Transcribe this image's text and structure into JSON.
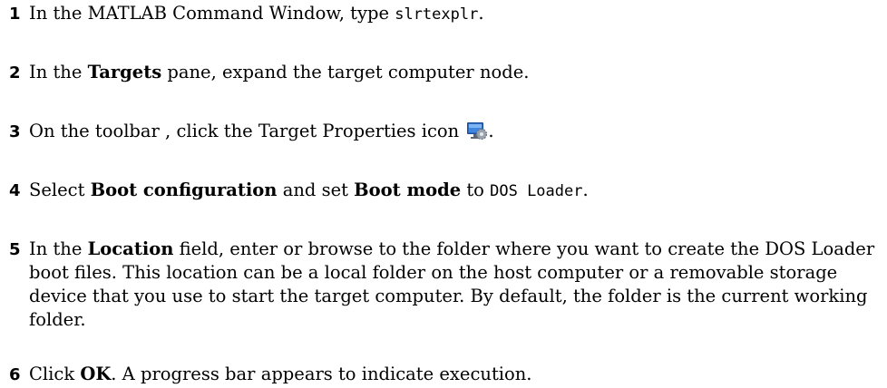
{
  "steps": [
    {
      "number": "1",
      "parts": {
        "a": "In the MATLAB Command Window, type ",
        "cmd": "slrtexplr",
        "b": "."
      }
    },
    {
      "number": "2",
      "parts": {
        "a": "In the ",
        "bold1": "Targets",
        "b": " pane, expand the target computer node."
      }
    },
    {
      "number": "3",
      "parts": {
        "a": "On the toolbar , click the Target Properties icon ",
        "b": "."
      },
      "icon": "target-properties-icon"
    },
    {
      "number": "4",
      "parts": {
        "a": "Select ",
        "bold1": "Boot configuration",
        "b": " and set ",
        "bold2": "Boot mode",
        "c": " to ",
        "code": "DOS Loader",
        "d": "."
      }
    },
    {
      "number": "5",
      "parts": {
        "a": "In the ",
        "bold1": "Location",
        "b": " field, enter or browse to the folder where you want to create the DOS Loader boot files. This location can be a local folder on the host computer or a removable storage device that you use to start the target computer. By default, the folder is the current working folder."
      }
    },
    {
      "number": "6",
      "parts": {
        "a": "Click ",
        "bold1": "OK",
        "b": ". A progress bar appears to indicate execution."
      }
    }
  ],
  "colors": {
    "text": "#000000",
    "background": "#ffffff",
    "icon_monitor": "#2f6fcf",
    "icon_gear": "#9aa3ad"
  }
}
